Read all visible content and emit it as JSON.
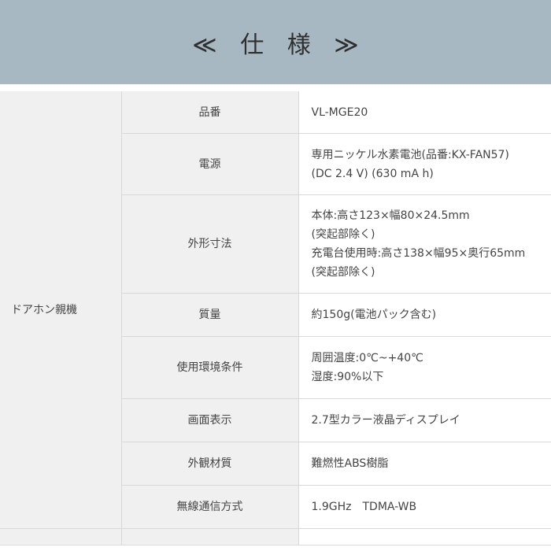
{
  "header": {
    "title": "≪ 仕 様 ≫"
  },
  "spec": {
    "group_label": "ドアホン親機",
    "rows": [
      {
        "label": "品番",
        "lines": [
          "VL-MGE20"
        ]
      },
      {
        "label": "電源",
        "lines": [
          "専用ニッケル水素電池(品番:KX-FAN57)",
          "(DC 2.4 V) (630 mA h)"
        ]
      },
      {
        "label": "外形寸法",
        "lines": [
          "本体:高さ123×幅80×24.5mm",
          "(突起部除く)",
          "充電台使用時:高さ138×幅95×奥行65mm",
          "(突起部除く)"
        ]
      },
      {
        "label": "質量",
        "lines": [
          "約150g(電池パック含む)"
        ]
      },
      {
        "label": "使用環境条件",
        "lines": [
          "周囲温度:0℃~+40℃",
          "湿度:90%以下"
        ]
      },
      {
        "label": "画面表示",
        "lines": [
          "2.7型カラー液晶ディスプレイ"
        ]
      },
      {
        "label": "外観材質",
        "lines": [
          "難燃性ABS樹脂"
        ]
      },
      {
        "label": "無線通信方式",
        "lines": [
          "1.9GHz　TDMA-WB"
        ]
      }
    ]
  }
}
